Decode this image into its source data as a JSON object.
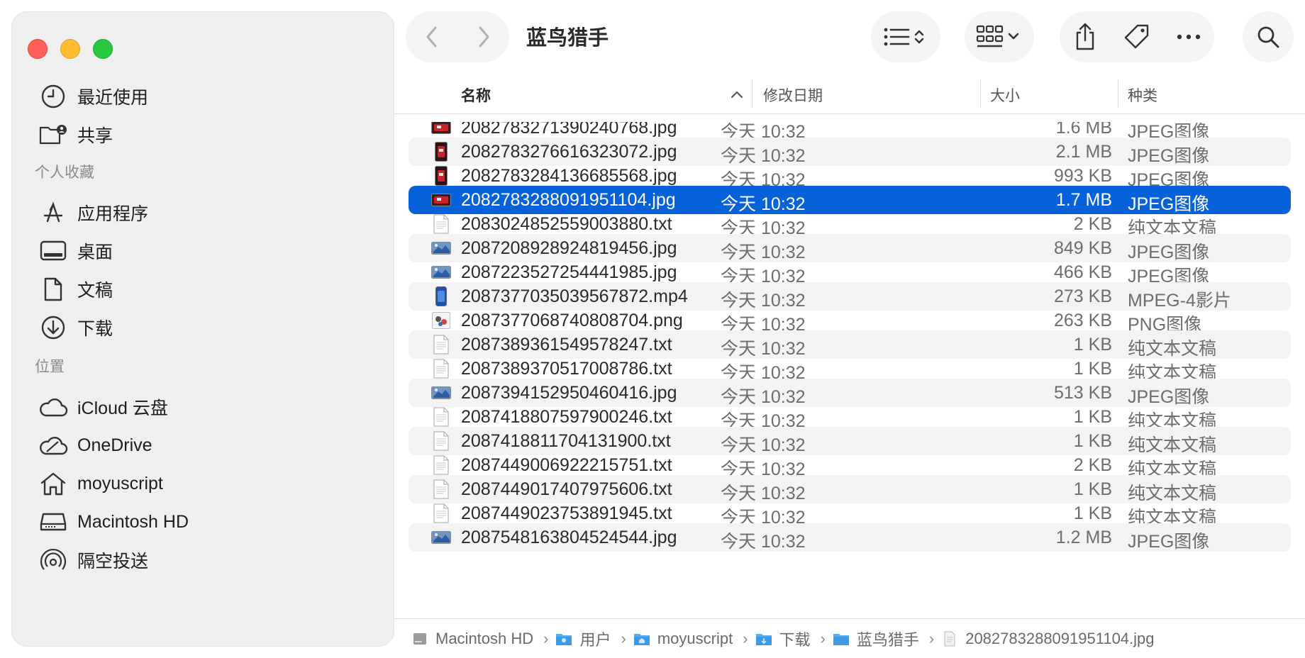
{
  "window": {
    "title": "蓝鸟猎手"
  },
  "sidebar": {
    "top_items": [
      {
        "label": "最近使用",
        "icon": "clock-icon"
      },
      {
        "label": "共享",
        "icon": "shared-folder-icon"
      }
    ],
    "favorites_header": "个人收藏",
    "favorites": [
      {
        "label": "应用程序",
        "icon": "applications-icon"
      },
      {
        "label": "桌面",
        "icon": "desktop-icon"
      },
      {
        "label": "文稿",
        "icon": "document-icon"
      },
      {
        "label": "下载",
        "icon": "download-icon"
      }
    ],
    "locations_header": "位置",
    "locations": [
      {
        "label": "iCloud 云盘",
        "icon": "cloud-icon"
      },
      {
        "label": "OneDrive",
        "icon": "onedrive-icon"
      },
      {
        "label": "moyuscript",
        "icon": "home-icon"
      },
      {
        "label": "Macintosh HD",
        "icon": "disk-icon"
      },
      {
        "label": "隔空投送",
        "icon": "airdrop-icon"
      }
    ]
  },
  "columns": {
    "name": "名称",
    "date": "修改日期",
    "size": "大小",
    "kind": "种类"
  },
  "files": [
    {
      "name": "2082783271390240768.jpg",
      "date": "今天 10:32",
      "size": "1.6 MB",
      "kind": "JPEG图像",
      "icon": "photo-red-wide"
    },
    {
      "name": "2082783276616323072.jpg",
      "date": "今天 10:32",
      "size": "2.1 MB",
      "kind": "JPEG图像",
      "icon": "photo-red-tall"
    },
    {
      "name": "2082783284136685568.jpg",
      "date": "今天 10:32",
      "size": "993 KB",
      "kind": "JPEG图像",
      "icon": "photo-red-tall"
    },
    {
      "name": "2082783288091951104.jpg",
      "date": "今天 10:32",
      "size": "1.7 MB",
      "kind": "JPEG图像",
      "icon": "photo-red-wide",
      "selected": true
    },
    {
      "name": "2083024852559003880.txt",
      "date": "今天 10:32",
      "size": "2 KB",
      "kind": "纯文本文稿",
      "icon": "text"
    },
    {
      "name": "2087208928924819456.jpg",
      "date": "今天 10:32",
      "size": "849 KB",
      "kind": "JPEG图像",
      "icon": "photo-blue-wide"
    },
    {
      "name": "2087223527254441985.jpg",
      "date": "今天 10:32",
      "size": "466 KB",
      "kind": "JPEG图像",
      "icon": "photo-blue-wide"
    },
    {
      "name": "2087377035039567872.mp4",
      "date": "今天 10:32",
      "size": "273 KB",
      "kind": "MPEG-4影片",
      "icon": "video-blue"
    },
    {
      "name": "2087377068740808704.png",
      "date": "今天 10:32",
      "size": "263 KB",
      "kind": "PNG图像",
      "icon": "png"
    },
    {
      "name": "2087389361549578247.txt",
      "date": "今天 10:32",
      "size": "1 KB",
      "kind": "纯文本文稿",
      "icon": "text"
    },
    {
      "name": "2087389370517008786.txt",
      "date": "今天 10:32",
      "size": "1 KB",
      "kind": "纯文本文稿",
      "icon": "text"
    },
    {
      "name": "2087394152950460416.jpg",
      "date": "今天 10:32",
      "size": "513 KB",
      "kind": "JPEG图像",
      "icon": "photo-blue-wide"
    },
    {
      "name": "2087418807597900246.txt",
      "date": "今天 10:32",
      "size": "1 KB",
      "kind": "纯文本文稿",
      "icon": "text"
    },
    {
      "name": "2087418811704131900.txt",
      "date": "今天 10:32",
      "size": "1 KB",
      "kind": "纯文本文稿",
      "icon": "text"
    },
    {
      "name": "2087449006922215751.txt",
      "date": "今天 10:32",
      "size": "2 KB",
      "kind": "纯文本文稿",
      "icon": "text"
    },
    {
      "name": "2087449017407975606.txt",
      "date": "今天 10:32",
      "size": "1 KB",
      "kind": "纯文本文稿",
      "icon": "text"
    },
    {
      "name": "2087449023753891945.txt",
      "date": "今天 10:32",
      "size": "1 KB",
      "kind": "纯文本文稿",
      "icon": "text"
    },
    {
      "name": "2087548163804524544.jpg",
      "date": "今天 10:32",
      "size": "1.2 MB",
      "kind": "JPEG图像",
      "icon": "photo-blue-wide"
    }
  ],
  "pathbar": [
    {
      "label": "Macintosh HD",
      "icon": "disk-icon"
    },
    {
      "label": "用户",
      "icon": "folder-icon"
    },
    {
      "label": "moyuscript",
      "icon": "home-folder-icon"
    },
    {
      "label": "下载",
      "icon": "download-folder-icon"
    },
    {
      "label": "蓝鸟猎手",
      "icon": "folder-icon"
    },
    {
      "label": "2082783288091951104.jpg",
      "icon": "file-icon"
    }
  ],
  "colors": {
    "selection": "#0761d9",
    "sidebar_bg": "#efefef",
    "folder": "#3b9be6"
  }
}
